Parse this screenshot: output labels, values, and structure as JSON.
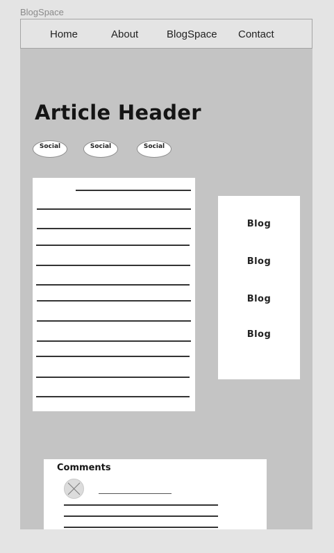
{
  "frame": {
    "label": "BlogSpace"
  },
  "nav": {
    "items": [
      "Home",
      "About",
      "BlogSpace",
      "Contact"
    ]
  },
  "article": {
    "header": "Article Header"
  },
  "social": {
    "buttons": [
      "Social",
      "Social",
      "Social"
    ]
  },
  "sidebar": {
    "blogs": [
      "Blog",
      "Blog",
      "Blog",
      "Blog"
    ]
  },
  "comments": {
    "title": "Comments"
  }
}
